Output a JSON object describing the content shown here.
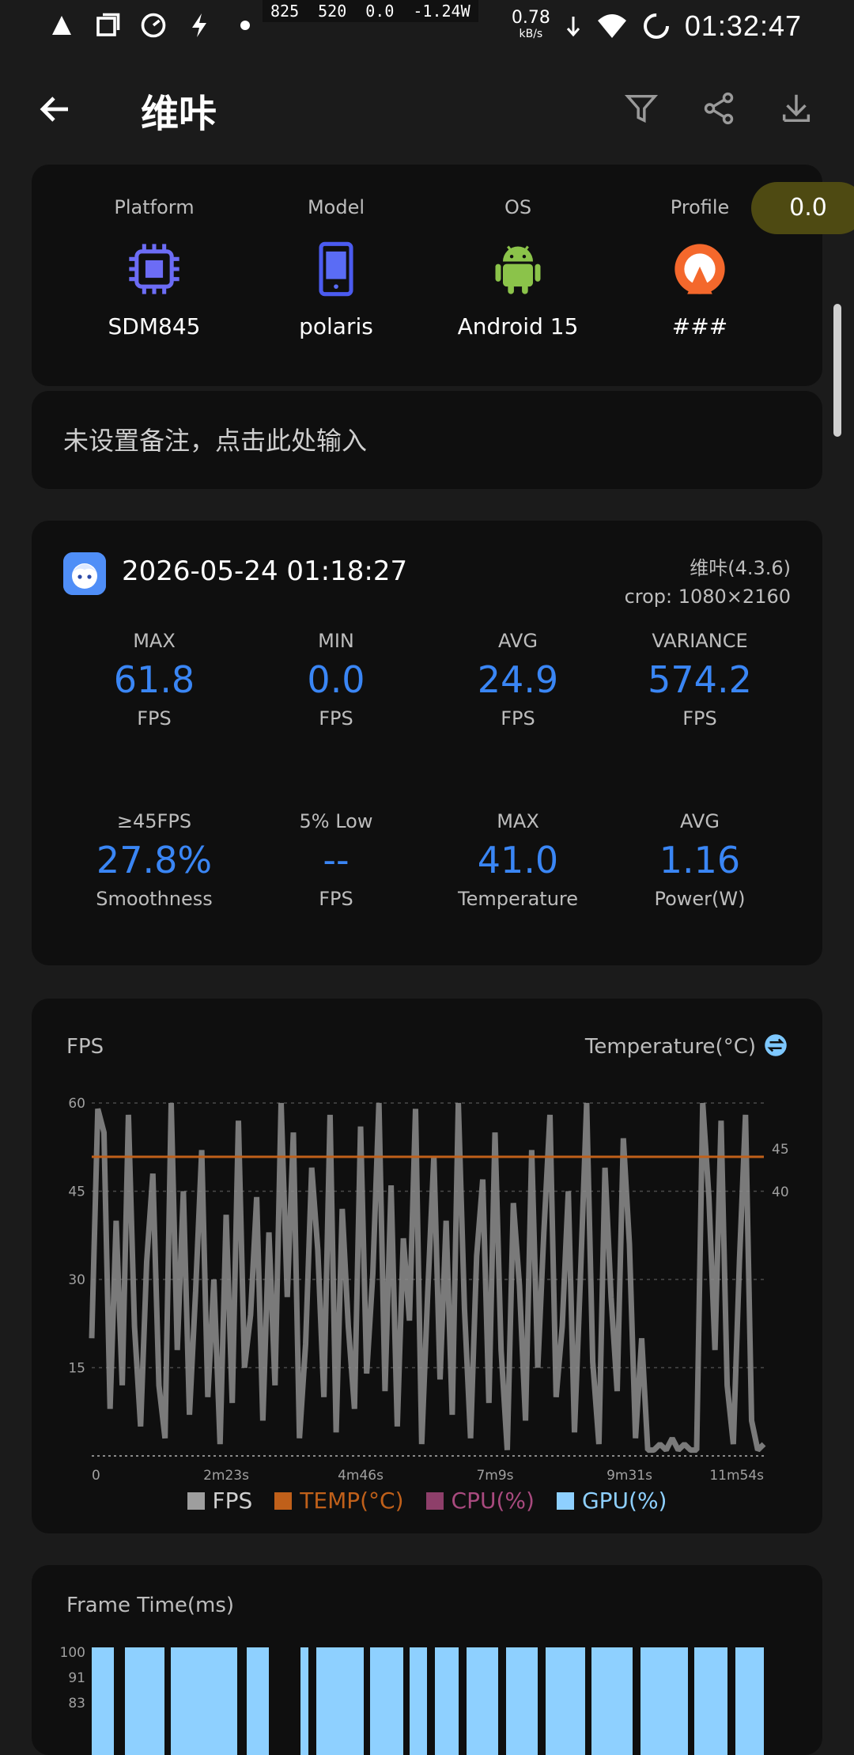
{
  "status_bar": {
    "overlay": [
      "825",
      "520",
      "0.0",
      "-1.24W"
    ],
    "net_speed": "0.78",
    "net_unit": "kB/s",
    "time": "01:32:47"
  },
  "header": {
    "title": "维咔"
  },
  "device": {
    "platform_label": "Platform",
    "platform_value": "SDM845",
    "model_label": "Model",
    "model_value": "polaris",
    "os_label": "OS",
    "os_value": "Android 15",
    "profile_label": "Profile",
    "profile_value": "###",
    "score": "0.0"
  },
  "note": {
    "placeholder": "未设置备注，点击此处输入"
  },
  "session": {
    "datetime": "2026-05-24 01:18:27",
    "app_version": "维咔(4.3.6)",
    "crop": "crop: 1080×2160",
    "stats": [
      {
        "title": "MAX",
        "value": "61.8",
        "unit": "FPS"
      },
      {
        "title": "MIN",
        "value": "0.0",
        "unit": "FPS"
      },
      {
        "title": "AVG",
        "value": "24.9",
        "unit": "FPS"
      },
      {
        "title": "VARIANCE",
        "value": "574.2",
        "unit": "FPS"
      },
      {
        "title": "≥45FPS",
        "value": "27.8%",
        "unit": "Smoothness"
      },
      {
        "title": "5% Low",
        "value": "--",
        "unit": "FPS"
      },
      {
        "title": "MAX",
        "value": "41.0",
        "unit": "Temperature"
      },
      {
        "title": "AVG",
        "value": "1.16",
        "unit": "Power(W)"
      }
    ]
  },
  "fps_chart": {
    "title": "FPS",
    "right_title": "Temperature(°C)",
    "legend": [
      {
        "label": "FPS",
        "color": "#9e9e9e"
      },
      {
        "label": "TEMP(°C)",
        "color": "#c0601a"
      },
      {
        "label": "CPU(%)",
        "color": "#8e3f6a"
      },
      {
        "label": "GPU(%)",
        "color": "#8ed0ff"
      }
    ]
  },
  "chart_data": {
    "type": "line",
    "x_tick_labels": [
      "0",
      "2m23s",
      "4m46s",
      "7m9s",
      "9m31s",
      "11m54s"
    ],
    "y_left_ticks": [
      15,
      30,
      45,
      60
    ],
    "y_right_ticks": [
      40,
      45
    ],
    "ylim": [
      0,
      60
    ],
    "series": [
      {
        "name": "FPS",
        "values": [
          20,
          59,
          55,
          8,
          40,
          12,
          58,
          22,
          5,
          33,
          48,
          12,
          3,
          60,
          18,
          45,
          7,
          28,
          52,
          10,
          30,
          2,
          41,
          9,
          57,
          15,
          24,
          44,
          6,
          38,
          12,
          60,
          27,
          55,
          3,
          19,
          49,
          35,
          10,
          58,
          4,
          42,
          22,
          8,
          56,
          14,
          31,
          60,
          11,
          46,
          5,
          37,
          23,
          59,
          2,
          28,
          51,
          13,
          40,
          7,
          60,
          25,
          3,
          34,
          47,
          9,
          55,
          18,
          1,
          43,
          29,
          6,
          52,
          15,
          38,
          58,
          10,
          22,
          45,
          4,
          31,
          60,
          16,
          2,
          49,
          27,
          11,
          54,
          36,
          3,
          20,
          1,
          1,
          2,
          1,
          3,
          1,
          2,
          1,
          1,
          60,
          44,
          18,
          57,
          12,
          2,
          33,
          58,
          6,
          1,
          2
        ]
      },
      {
        "name": "TEMP(°C)",
        "values": [
          41,
          41,
          41,
          41,
          41,
          41,
          41,
          41,
          41,
          41,
          41
        ]
      }
    ]
  },
  "frame_time_chart": {
    "title": "Frame Time(ms)",
    "y_ticks": [
      "100",
      "91",
      "83"
    ]
  }
}
